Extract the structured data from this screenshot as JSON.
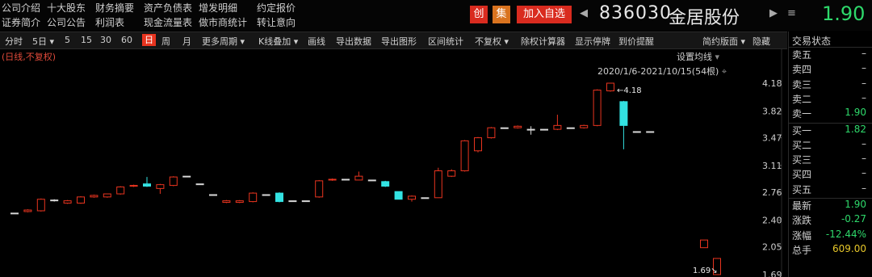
{
  "top_links": [
    {
      "label": "公司介绍",
      "row": 0,
      "col": 0
    },
    {
      "label": "十大股东",
      "row": 0,
      "col": 1
    },
    {
      "label": "财务摘要",
      "row": 0,
      "col": 2
    },
    {
      "label": "资产负债表",
      "row": 0,
      "col": 3
    },
    {
      "label": "增发明细",
      "row": 0,
      "col": 4
    },
    {
      "label": "约定报价",
      "row": 0,
      "col": 5
    },
    {
      "label": "证券简介",
      "row": 1,
      "col": 0
    },
    {
      "label": "公司公告",
      "row": 1,
      "col": 1
    },
    {
      "label": "利润表",
      "row": 1,
      "col": 2
    },
    {
      "label": "现金流量表",
      "row": 1,
      "col": 3
    },
    {
      "label": "做市商统计",
      "row": 1,
      "col": 4
    },
    {
      "label": "转让意向",
      "row": 1,
      "col": 5
    }
  ],
  "tags": {
    "chuang": "创",
    "ji": "集",
    "add": "加入自选"
  },
  "stock": {
    "code": "836030",
    "name": "金居股份",
    "price": "1.90"
  },
  "toolbar": {
    "items": [
      "分时",
      "5日",
      "5",
      "15",
      "30",
      "60",
      "日",
      "周",
      "月",
      "更多周期",
      "K线叠加",
      "画线",
      "导出数据",
      "导出图形",
      "区间统计",
      "不复权",
      "除权计算器",
      "显示停牌",
      "到价提醒",
      "简约版面",
      "隐藏"
    ],
    "active": "日"
  },
  "chart": {
    "note": "(日线,不复权)",
    "ma_setting": "设置均线",
    "range_label": "2020/1/6-2021/10/15(54根)",
    "high_label": "4.18",
    "low_label": "1.69"
  },
  "chart_data": {
    "type": "candlestick",
    "y_ticks": [
      "4.18",
      "3.82",
      "3.47",
      "3.11",
      "2.76",
      "2.40",
      "2.05",
      "1.69"
    ],
    "candles": [
      {
        "o": 2.49,
        "c": 2.49,
        "h": 2.49,
        "l": 2.49
      },
      {
        "o": 2.51,
        "c": 2.53,
        "h": 2.54,
        "l": 2.5
      },
      {
        "o": 2.52,
        "c": 2.67,
        "h": 2.68,
        "l": 2.51
      },
      {
        "o": 2.66,
        "c": 2.66,
        "h": 2.67,
        "l": 2.64
      },
      {
        "o": 2.62,
        "c": 2.65,
        "h": 2.66,
        "l": 2.61
      },
      {
        "o": 2.62,
        "c": 2.7,
        "h": 2.71,
        "l": 2.61
      },
      {
        "o": 2.7,
        "c": 2.72,
        "h": 2.73,
        "l": 2.69
      },
      {
        "o": 2.7,
        "c": 2.74,
        "h": 2.74,
        "l": 2.69
      },
      {
        "o": 2.74,
        "c": 2.83,
        "h": 2.84,
        "l": 2.73
      },
      {
        "o": 2.84,
        "c": 2.85,
        "h": 2.86,
        "l": 2.83
      },
      {
        "o": 2.87,
        "c": 2.84,
        "h": 2.96,
        "l": 2.83
      },
      {
        "o": 2.81,
        "c": 2.86,
        "h": 2.87,
        "l": 2.74
      },
      {
        "o": 2.85,
        "c": 2.96,
        "h": 2.97,
        "l": 2.84
      },
      {
        "o": 2.97,
        "c": 2.97,
        "h": 2.97,
        "l": 2.97
      },
      {
        "o": 2.87,
        "c": 2.87,
        "h": 2.87,
        "l": 2.87
      },
      {
        "o": 2.73,
        "c": 2.73,
        "h": 2.73,
        "l": 2.73
      },
      {
        "o": 2.63,
        "c": 2.65,
        "h": 2.66,
        "l": 2.62
      },
      {
        "o": 2.63,
        "c": 2.65,
        "h": 2.66,
        "l": 2.62
      },
      {
        "o": 2.64,
        "c": 2.75,
        "h": 2.76,
        "l": 2.63
      },
      {
        "o": 2.73,
        "c": 2.73,
        "h": 2.73,
        "l": 2.73
      },
      {
        "o": 2.75,
        "c": 2.64,
        "h": 2.76,
        "l": 2.63
      },
      {
        "o": 2.65,
        "c": 2.65,
        "h": 2.65,
        "l": 2.65
      },
      {
        "o": 2.65,
        "c": 2.65,
        "h": 2.65,
        "l": 2.65
      },
      {
        "o": 2.7,
        "c": 2.91,
        "h": 2.92,
        "l": 2.69
      },
      {
        "o": 2.92,
        "c": 2.93,
        "h": 2.94,
        "l": 2.91
      },
      {
        "o": 2.93,
        "c": 2.93,
        "h": 2.93,
        "l": 2.93
      },
      {
        "o": 2.92,
        "c": 2.97,
        "h": 3.03,
        "l": 2.92
      },
      {
        "o": 2.92,
        "c": 2.92,
        "h": 2.92,
        "l": 2.92
      },
      {
        "o": 2.9,
        "c": 2.84,
        "h": 2.91,
        "l": 2.83
      },
      {
        "o": 2.77,
        "c": 2.67,
        "h": 2.77,
        "l": 2.67
      },
      {
        "o": 2.67,
        "c": 2.71,
        "h": 2.72,
        "l": 2.64
      },
      {
        "o": 2.69,
        "c": 2.69,
        "h": 2.69,
        "l": 2.69
      },
      {
        "o": 2.69,
        "c": 3.04,
        "h": 3.08,
        "l": 2.69
      },
      {
        "o": 2.97,
        "c": 3.04,
        "h": 3.06,
        "l": 2.96
      },
      {
        "o": 3.04,
        "c": 3.43,
        "h": 3.44,
        "l": 3.03
      },
      {
        "o": 3.3,
        "c": 3.47,
        "h": 3.48,
        "l": 3.28
      },
      {
        "o": 3.47,
        "c": 3.6,
        "h": 3.61,
        "l": 3.46
      },
      {
        "o": 3.6,
        "c": 3.6,
        "h": 3.6,
        "l": 3.6
      },
      {
        "o": 3.6,
        "c": 3.62,
        "h": 3.63,
        "l": 3.59
      },
      {
        "o": 3.58,
        "c": 3.58,
        "h": 3.62,
        "l": 3.51
      },
      {
        "o": 3.58,
        "c": 3.58,
        "h": 3.58,
        "l": 3.58
      },
      {
        "o": 3.58,
        "c": 3.63,
        "h": 3.77,
        "l": 3.57
      },
      {
        "o": 3.6,
        "c": 3.6,
        "h": 3.6,
        "l": 3.6
      },
      {
        "o": 3.6,
        "c": 3.63,
        "h": 3.64,
        "l": 3.59
      },
      {
        "o": 3.63,
        "c": 4.09,
        "h": 4.1,
        "l": 3.62
      },
      {
        "o": 4.08,
        "c": 4.18,
        "h": 4.18,
        "l": 4.07
      },
      {
        "o": 3.94,
        "c": 3.63,
        "h": 3.95,
        "l": 3.32
      },
      {
        "o": 3.55,
        "c": 3.55,
        "h": 3.55,
        "l": 3.55
      },
      {
        "o": 3.55,
        "c": 3.55,
        "h": 3.55,
        "l": 3.55
      },
      {
        "o": 2.04,
        "c": 2.14,
        "h": 2.14,
        "l": 2.04
      },
      {
        "o": 1.69,
        "c": 1.9,
        "h": 1.9,
        "l": 1.69
      }
    ],
    "colors": {
      "up": "#e8341f",
      "down": "#33e2e2",
      "flat": "#d8d8d8"
    }
  },
  "panel": {
    "title": "交易状态",
    "sell": [
      {
        "label": "卖五",
        "value": "–"
      },
      {
        "label": "卖四",
        "value": "–"
      },
      {
        "label": "卖三",
        "value": "–"
      },
      {
        "label": "卖二",
        "value": "–"
      },
      {
        "label": "卖一",
        "value": "1.90"
      }
    ],
    "buy": [
      {
        "label": "买一",
        "value": "1.82"
      },
      {
        "label": "买二",
        "value": "–"
      },
      {
        "label": "买三",
        "value": "–"
      },
      {
        "label": "买四",
        "value": "–"
      },
      {
        "label": "买五",
        "value": "–"
      }
    ],
    "stats": [
      {
        "label": "最新",
        "value": "1.90"
      },
      {
        "label": "涨跌",
        "value": "-0.27"
      },
      {
        "label": "涨幅",
        "value": "-12.44%"
      },
      {
        "label": "总手",
        "value": "609.00"
      }
    ]
  }
}
